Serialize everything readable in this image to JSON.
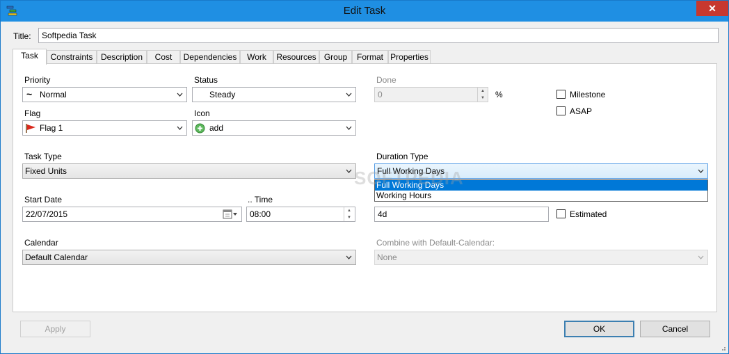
{
  "window": {
    "title": "Edit Task",
    "close_glyph": "✕"
  },
  "title_field": {
    "label": "Title:",
    "value": "Softpedia Task"
  },
  "tabs": [
    "Task",
    "Constraints",
    "Description",
    "Cost",
    "Dependencies",
    "Work",
    "Resources",
    "Group",
    "Format",
    "Properties"
  ],
  "priority": {
    "label": "Priority",
    "value": "Normal"
  },
  "status": {
    "label": "Status",
    "value": "Steady"
  },
  "done": {
    "label": "Done",
    "value": "0",
    "unit": "%"
  },
  "milestone": {
    "label": "Milestone",
    "checked": false
  },
  "asap": {
    "label": "ASAP",
    "checked": false
  },
  "flag": {
    "label": "Flag",
    "value": "Flag 1"
  },
  "icon_field": {
    "label": "Icon",
    "value": "add"
  },
  "task_type": {
    "label": "Task Type",
    "value": "Fixed Units"
  },
  "duration_type": {
    "label": "Duration Type",
    "value": "Full Working Days",
    "options": [
      "Full Working Days",
      "Working Hours"
    ]
  },
  "start_date": {
    "label": "Start Date",
    "value": "22/07/2015"
  },
  "time": {
    "label": ".. Time",
    "value": "08:00"
  },
  "duration": {
    "value": "4d"
  },
  "estimated": {
    "label": "Estimated",
    "checked": false
  },
  "calendar": {
    "label": "Calendar",
    "value": "Default Calendar"
  },
  "combine": {
    "label": "Combine with Default-Calendar:",
    "value": "None"
  },
  "buttons": {
    "apply": "Apply",
    "ok": "OK",
    "cancel": "Cancel"
  },
  "watermark": "SOFTPEDIA",
  "colors": {
    "titlebar": "#1f8fe3",
    "close": "#c7382f",
    "selection": "#0078d7"
  }
}
